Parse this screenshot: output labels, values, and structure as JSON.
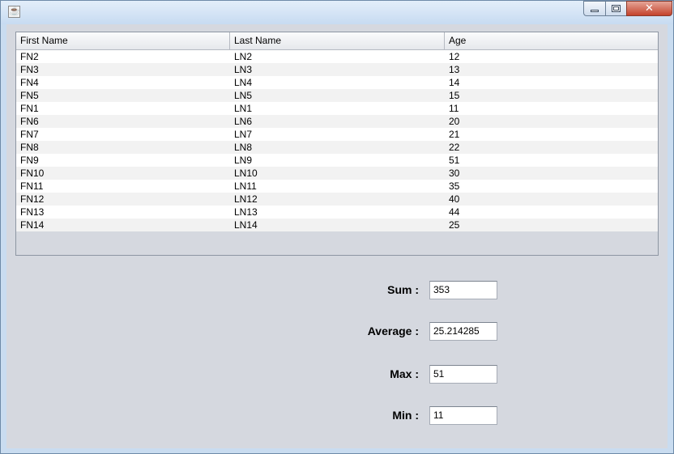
{
  "window": {
    "title": "",
    "icon": "java-cup-icon",
    "controls": {
      "close": "✕"
    }
  },
  "table": {
    "columns": [
      "First Name",
      "Last Name",
      "Age"
    ],
    "rows": [
      [
        "FN2",
        "LN2",
        "12"
      ],
      [
        "FN3",
        "LN3",
        "13"
      ],
      [
        "FN4",
        "LN4",
        "14"
      ],
      [
        "FN5",
        "LN5",
        "15"
      ],
      [
        "FN1",
        "LN1",
        "11"
      ],
      [
        "FN6",
        "LN6",
        "20"
      ],
      [
        "FN7",
        "LN7",
        "21"
      ],
      [
        "FN8",
        "LN8",
        "22"
      ],
      [
        "FN9",
        "LN9",
        "51"
      ],
      [
        "FN10",
        "LN10",
        "30"
      ],
      [
        "FN11",
        "LN11",
        "35"
      ],
      [
        "FN12",
        "LN12",
        "40"
      ],
      [
        "FN13",
        "LN13",
        "44"
      ],
      [
        "FN14",
        "LN14",
        "25"
      ]
    ]
  },
  "stats": {
    "sum": {
      "label": "Sum :",
      "value": "353"
    },
    "average": {
      "label": "Average :",
      "value": "25.214285"
    },
    "max": {
      "label": "Max :",
      "value": "51"
    },
    "min": {
      "label": "Min :",
      "value": "11"
    }
  }
}
